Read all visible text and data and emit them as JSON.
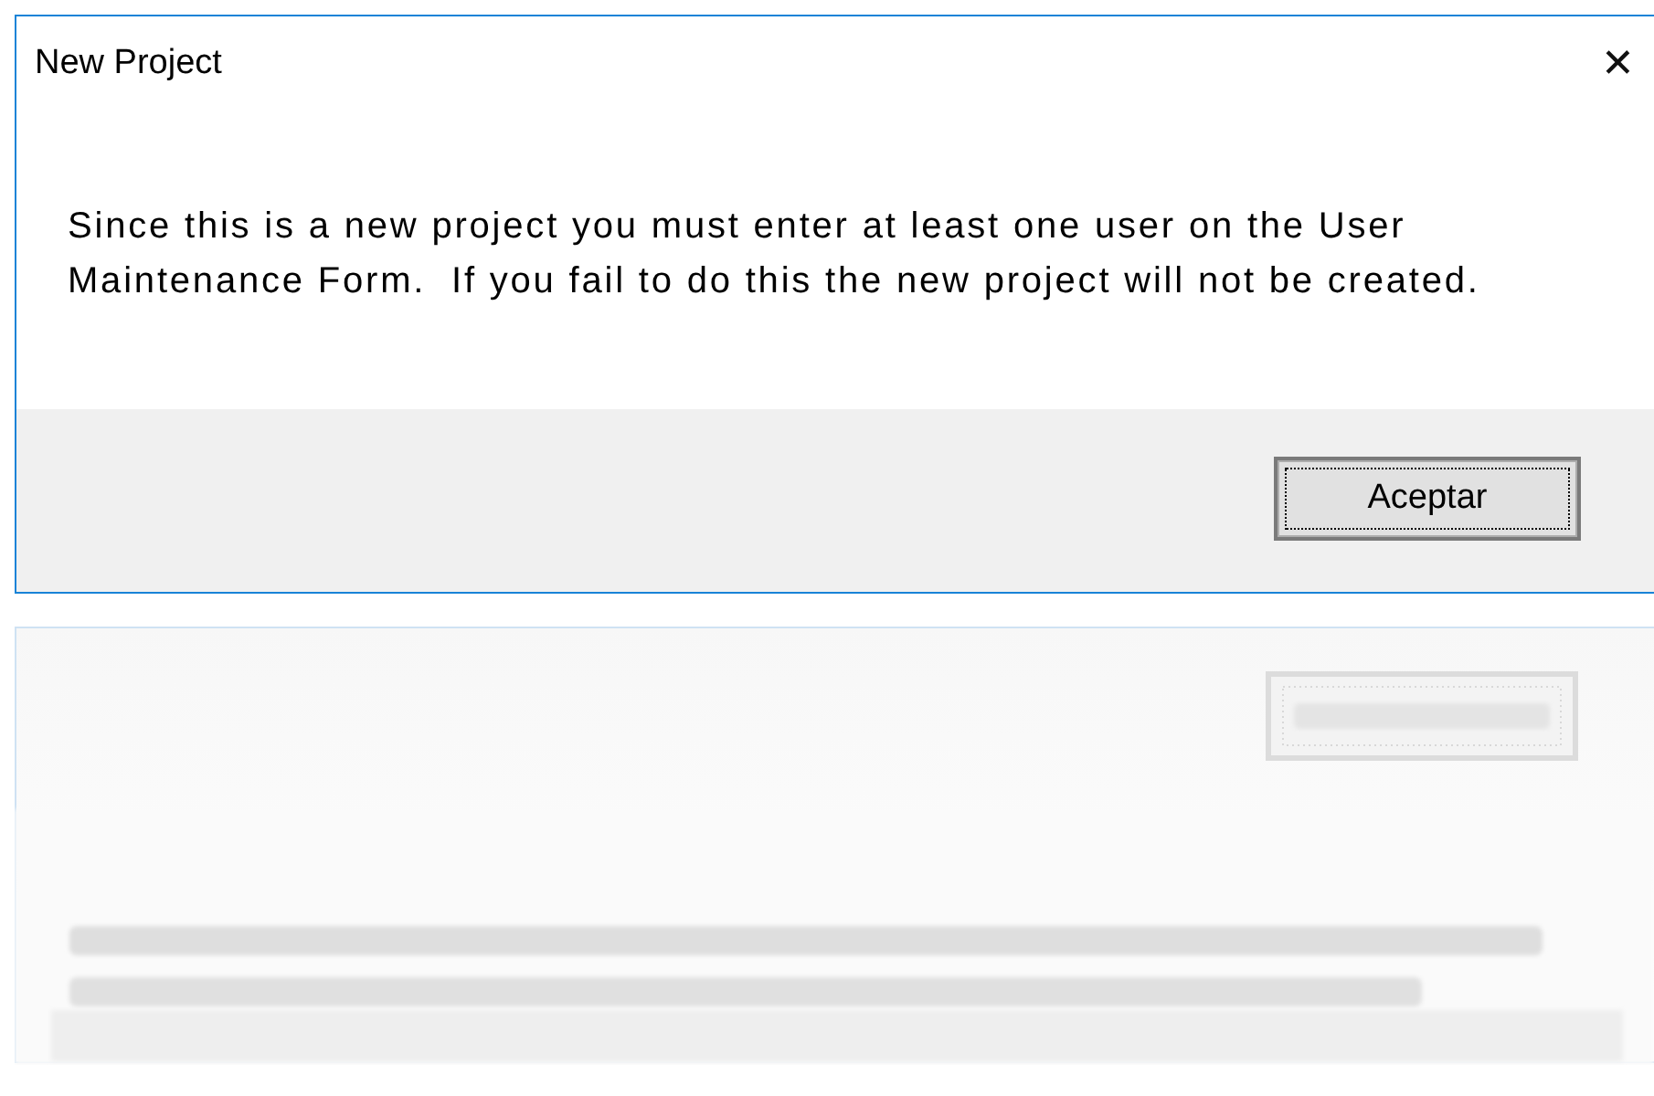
{
  "window": {
    "title": "New Project",
    "close": "✕"
  },
  "message": "Since this is a new project you must enter at least one user on the User Maintenance Form.  If you fail to do this the new project will not be created.",
  "buttons": [
    {
      "label": "Aceptar",
      "selected": true
    }
  ]
}
